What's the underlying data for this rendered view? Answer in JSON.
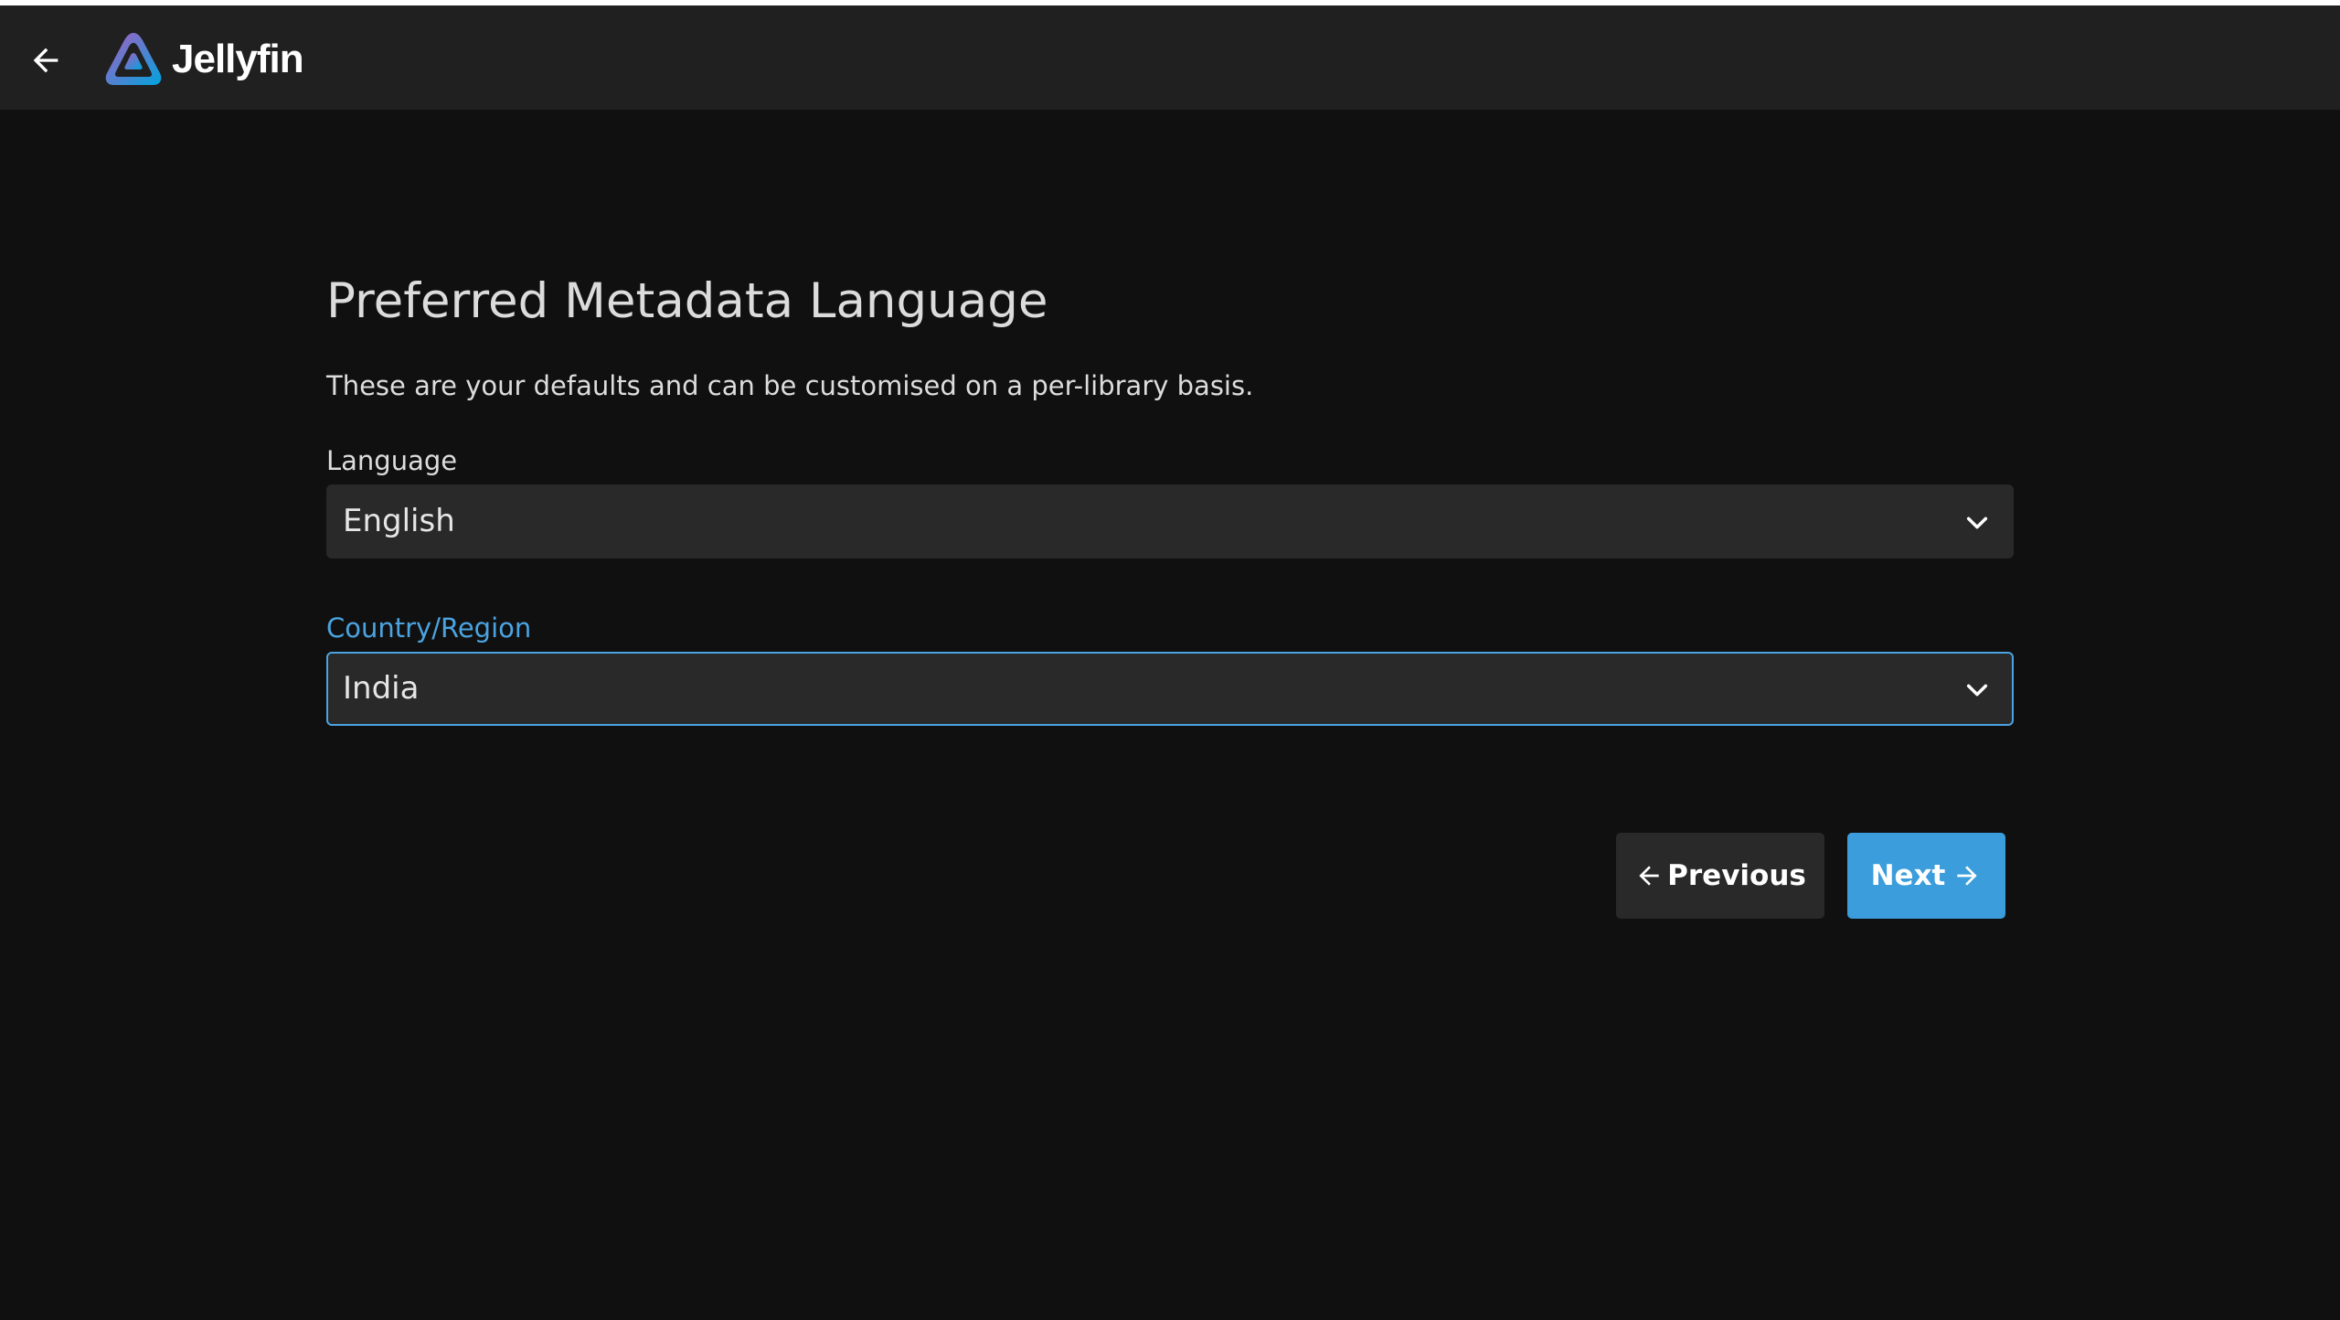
{
  "header": {
    "app_name": "Jellyfin",
    "back_icon": "arrow-left-icon",
    "logo_icon": "jellyfin-triangle-logo",
    "background": "#202020"
  },
  "main": {
    "title": "Preferred Metadata Language",
    "description": "These are your defaults and can be customised on a per-library basis.",
    "language": {
      "label": "Language",
      "value": "English"
    },
    "country": {
      "label": "Country/Region",
      "value": "India",
      "focused": true
    }
  },
  "buttons": {
    "previous_label": "Previous",
    "previous_icon": "arrow-left-icon",
    "next_label": "Next",
    "next_icon": "arrow-right-icon"
  },
  "colors": {
    "accent": "#3b9ddb",
    "focus_label": "#4ba3e0",
    "page_background": "#101010",
    "field_background": "#292929"
  }
}
